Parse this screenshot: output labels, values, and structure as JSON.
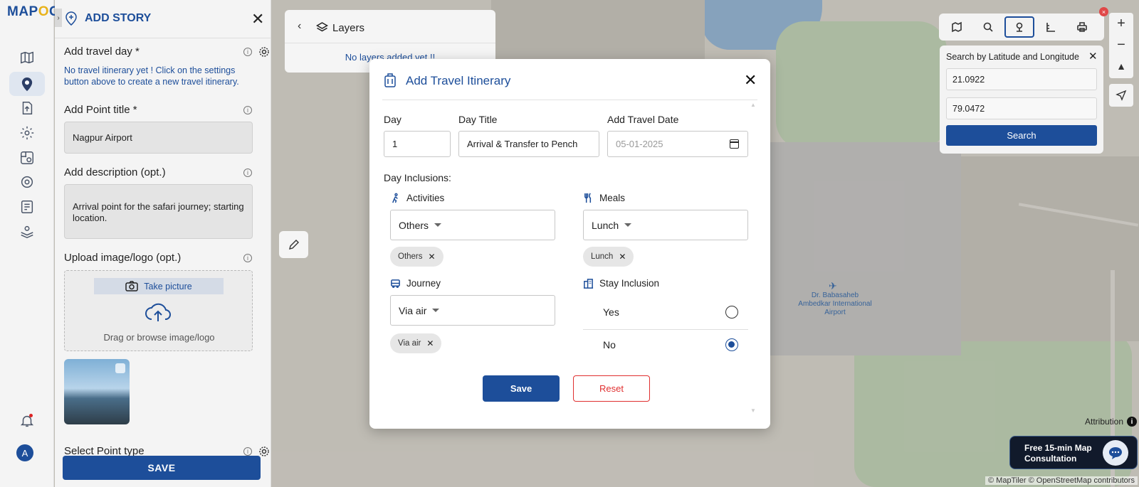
{
  "brand": {
    "logo_text_a": "MAP",
    "logo_text_b": "O",
    "logo_text_c": "G"
  },
  "rail": {
    "icons": [
      "map-icon",
      "location-pin-icon",
      "upload-file-icon",
      "gear-icon",
      "map-settings-icon",
      "settings-icon",
      "report-icon",
      "map-user-icon",
      "bell-icon"
    ],
    "avatar": "A"
  },
  "panel": {
    "title": "ADD STORY",
    "travel_day_label": "Add travel day *",
    "travel_day_hint": "No travel itinerary yet ! Click on the settings button above to create a new travel itinerary.",
    "point_title_label": "Add Point title *",
    "point_title_value": "Nagpur Airport",
    "description_label": "Add description (opt.)",
    "description_value": "Arrival point for the safari journey; starting location.",
    "upload_label": "Upload image/logo (opt.)",
    "take_picture": "Take picture",
    "drag_text": "Drag or browse image/logo",
    "point_type_label": "Select Point type",
    "save_label": "SAVE"
  },
  "layers": {
    "title": "Layers",
    "empty_text": "No layers added yet !!"
  },
  "latlng": {
    "title": "Search by Latitude and Longitude",
    "latitude": "21.0922",
    "longitude": "79.0472",
    "search_label": "Search"
  },
  "toolbar": {
    "icons": [
      "map-view-icon",
      "search-icon",
      "location-icon",
      "measure-icon",
      "print-icon"
    ],
    "badge": "×"
  },
  "zoom": {
    "in": "+",
    "out": "−"
  },
  "map": {
    "airport_label": "Dr. Babasaheb Ambedkar International Airport",
    "attribution": "Attribution",
    "credits": "© MapTiler © OpenStreetMap contributors"
  },
  "consult": {
    "text": "Free 15-min Map Consultation"
  },
  "modal": {
    "title": "Add Travel Itinerary",
    "day_label": "Day",
    "day_value": "1",
    "day_title_label": "Day Title",
    "day_title_value": "Arrival & Transfer to Pench",
    "date_label": "Add Travel Date",
    "date_value": "05-01-2025",
    "inclusions_label": "Day Inclusions:",
    "activities_label": "Activities",
    "activities_value": "Others",
    "activities_chip": "Others",
    "meals_label": "Meals",
    "meals_value": "Lunch",
    "meals_chip": "Lunch",
    "journey_label": "Journey",
    "journey_value": "Via air",
    "journey_chip": "Via air",
    "stay_label": "Stay Inclusion",
    "stay_yes": "Yes",
    "stay_no": "No",
    "stay_selected": "No",
    "save_label": "Save",
    "reset_label": "Reset"
  },
  "colors": {
    "accent": "#1d4e9a",
    "danger": "#e03030",
    "logo_o": "#e8b21a"
  }
}
